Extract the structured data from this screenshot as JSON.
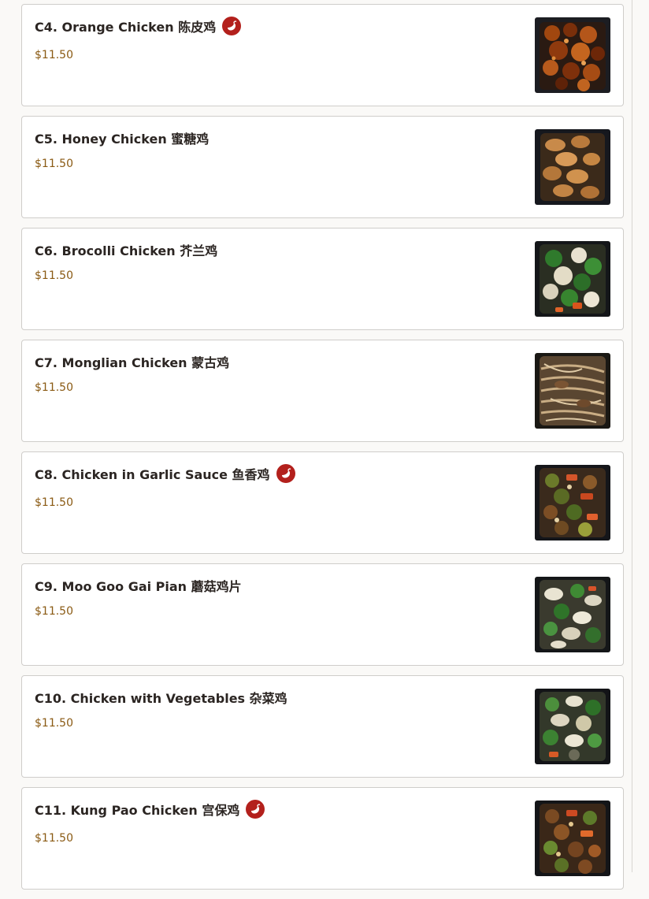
{
  "menu": {
    "items": [
      {
        "title": "C4. Orange Chicken 陈皮鸡",
        "price": "$11.50",
        "spicy": true,
        "photo": "orange-chicken-photo"
      },
      {
        "title": "C5. Honey Chicken 蜜糖鸡",
        "price": "$11.50",
        "spicy": false,
        "photo": "honey-chicken-photo"
      },
      {
        "title": "C6. Brocolli Chicken 芥兰鸡",
        "price": "$11.50",
        "spicy": false,
        "photo": "broccoli-chicken-photo"
      },
      {
        "title": "C7. Monglian Chicken 蒙古鸡",
        "price": "$11.50",
        "spicy": false,
        "photo": "mongolian-chicken-photo"
      },
      {
        "title": "C8. Chicken in Garlic Sauce 鱼香鸡",
        "price": "$11.50",
        "spicy": true,
        "photo": "garlic-chicken-photo"
      },
      {
        "title": "C9. Moo Goo Gai Pian 蘑菇鸡片",
        "price": "$11.50",
        "spicy": false,
        "photo": "moo-goo-gai-pian-photo"
      },
      {
        "title": "C10. Chicken with Vegetables 杂菜鸡",
        "price": "$11.50",
        "spicy": false,
        "photo": "chicken-vegetables-photo"
      },
      {
        "title": "C11. Kung Pao Chicken 宫保鸡",
        "price": "$11.50",
        "spicy": true,
        "photo": "kung-pao-chicken-photo"
      }
    ]
  },
  "colors": {
    "price": "#8a5a13",
    "spicy_badge": "#b3201c",
    "title": "#2b2522"
  },
  "icons": {
    "spicy": "chili-pepper-icon"
  }
}
